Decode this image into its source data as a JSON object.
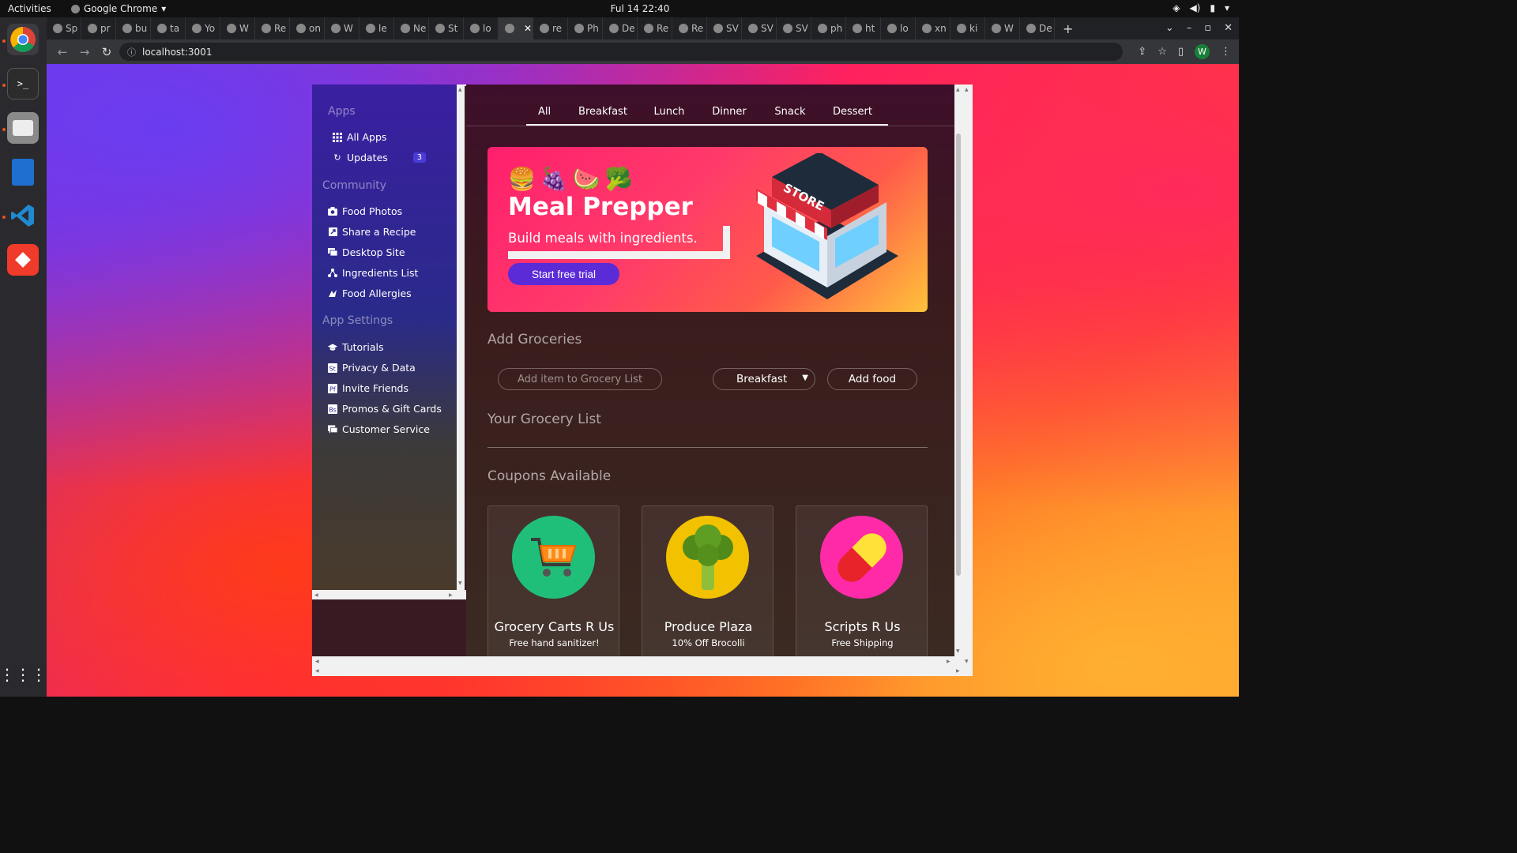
{
  "os": {
    "activities": "Activities",
    "app_name": "Google Chrome",
    "clock": "Ful 14  22:40"
  },
  "browser": {
    "tabs": [
      "Sp",
      "pr",
      "bu",
      "ta",
      "Yo",
      "W",
      "Re",
      "on",
      "W",
      "le",
      "Ne",
      "St",
      "lo",
      "",
      "re",
      "Ph",
      "De",
      "Re",
      "Re",
      "SV",
      "SV",
      "SV",
      "ph",
      "ht",
      "lo",
      "xn",
      "ki",
      "W",
      "De"
    ],
    "url": "localhost:3001",
    "profile_initial": "W"
  },
  "sidebar": {
    "sections": [
      {
        "label": "Apps"
      },
      {
        "label": "Community"
      },
      {
        "label": "App Settings"
      }
    ],
    "apps": [
      {
        "label": "All Apps",
        "icon": "grid-icon"
      },
      {
        "label": "Updates",
        "icon": "refresh-icon",
        "badge": "3"
      }
    ],
    "community": [
      {
        "label": "Food Photos",
        "icon": "camera-icon"
      },
      {
        "label": "Share a Recipe",
        "icon": "share-icon"
      },
      {
        "label": "Desktop Site",
        "icon": "desktop-icon"
      },
      {
        "label": "Ingredients List",
        "icon": "sitemap-icon"
      },
      {
        "label": "Food Allergies",
        "icon": "allergy-icon"
      }
    ],
    "settings": [
      {
        "label": "Tutorials",
        "icon": "graduation-cap-icon"
      },
      {
        "label": "Privacy & Data",
        "icon": "privacy-icon"
      },
      {
        "label": "Invite Friends",
        "icon": "invite-icon"
      },
      {
        "label": "Promos & Gift Cards",
        "icon": "gift-card-icon"
      },
      {
        "label": "Customer Service",
        "icon": "chat-icon"
      }
    ]
  },
  "meal_tabs": [
    "All",
    "Breakfast",
    "Lunch",
    "Dinner",
    "Snack",
    "Dessert"
  ],
  "hero": {
    "emojis": "🍔🍇🍉🥦",
    "title": "Meal Prepper",
    "subtitle": "Build meals with ingredients.",
    "cta": "Start free trial",
    "store_sign": "STORE"
  },
  "groceries": {
    "heading": "Add Groceries",
    "placeholder": "Add item to Grocery List",
    "selected_meal": "Breakfast",
    "add_button": "Add food",
    "list_heading": "Your Grocery List"
  },
  "coupons": {
    "heading": "Coupons Available",
    "items": [
      {
        "name": "Grocery Carts R Us",
        "deal": "Free hand sanitizer!",
        "icon": "shopping-cart-icon",
        "color": "#1fbf7a"
      },
      {
        "name": "Produce Plaza",
        "deal": "10% Off Brocolli",
        "icon": "broccoli-icon",
        "color": "#f2c200"
      },
      {
        "name": "Scripts R Us",
        "deal": "Free Shipping",
        "icon": "pill-icon",
        "color": "#ff2aa8"
      }
    ]
  }
}
